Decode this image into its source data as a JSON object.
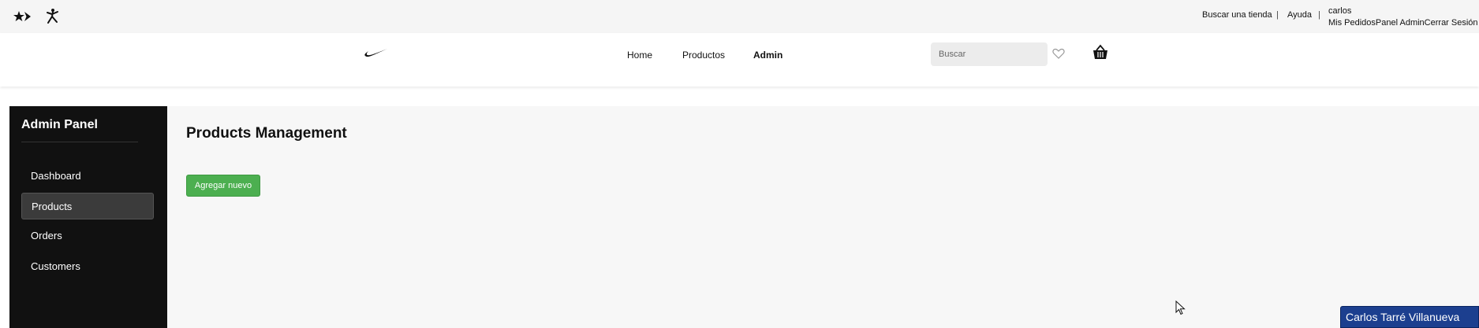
{
  "topbar": {
    "icons": [
      "converse-star-chevron-icon",
      "jordan-jumpman-icon"
    ],
    "find_store": "Buscar una tienda",
    "separator": "|",
    "help": "Ayuda",
    "user_name": "carlos",
    "user_links": "Mis PedidosPanel AdminCerrar Sesión"
  },
  "nav": {
    "logo": "nike-swoosh-icon",
    "links": [
      {
        "label": "Home"
      },
      {
        "label": "Productos"
      },
      {
        "label": "Admin"
      }
    ],
    "search_placeholder": "Buscar",
    "favorites_icon": "heart-icon",
    "cart_icon": "basket-icon"
  },
  "sidebar": {
    "title": "Admin Panel",
    "items": [
      {
        "label": "Dashboard"
      },
      {
        "label": "Products"
      },
      {
        "label": "Orders"
      },
      {
        "label": "Customers"
      }
    ]
  },
  "main": {
    "title": "Products Management",
    "add_button": "Agregar nuevo"
  },
  "watermark": "Carlos Tarré Villanueva",
  "colors": {
    "accent_green": "#4caf50",
    "sidebar_bg": "#111111",
    "sidebar_active": "#3b3b3b",
    "watermark_bg": "#1c3f8f"
  }
}
